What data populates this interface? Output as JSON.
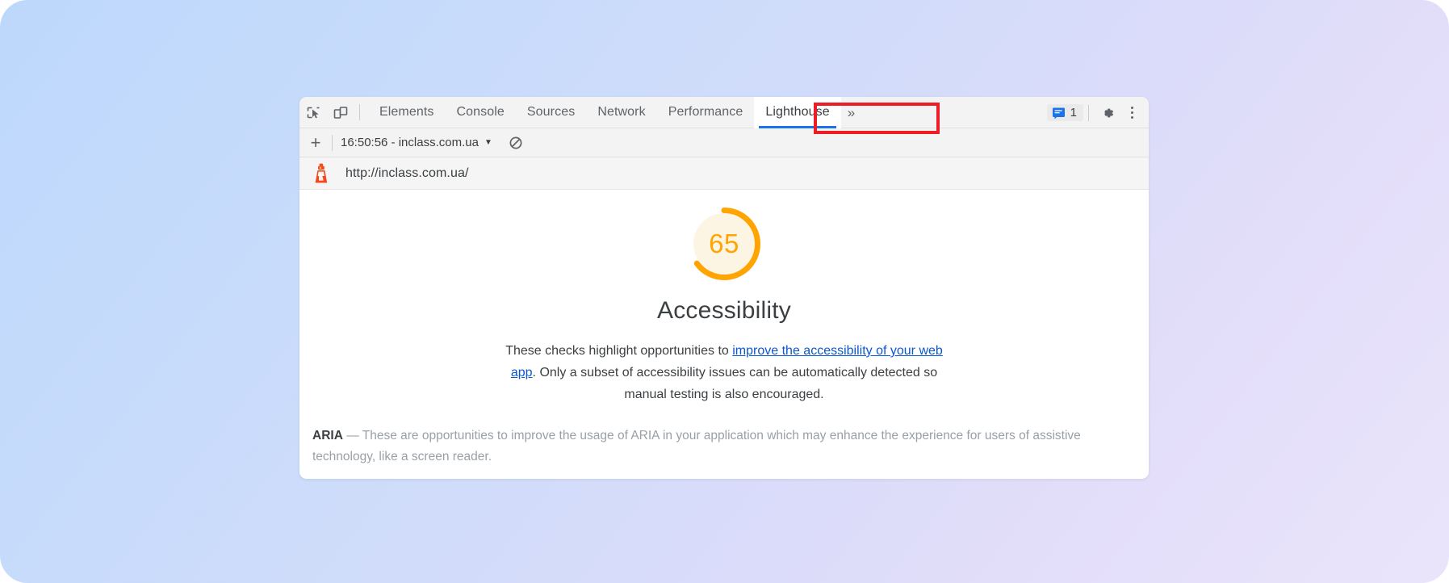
{
  "window": {
    "title": "Chrome DevTools - Lighthouse"
  },
  "toolbar": {
    "inspect_tooltip": "Inspect element",
    "device_tooltip": "Toggle device toolbar",
    "tabs": [
      {
        "label": "Elements",
        "active": false
      },
      {
        "label": "Console",
        "active": false
      },
      {
        "label": "Sources",
        "active": false
      },
      {
        "label": "Network",
        "active": false
      },
      {
        "label": "Performance",
        "active": false
      },
      {
        "label": "Lighthouse",
        "active": true
      }
    ],
    "more_tabs_glyph": "»",
    "message_count": "1",
    "settings_tooltip": "Settings",
    "menu_tooltip": "Customize and control DevTools"
  },
  "lighthouse_toolbar": {
    "add_label": "+",
    "report_selector": "16:50:56 - inclass.com.ua",
    "caret": "▼",
    "clear_tooltip": "Clear all"
  },
  "url_bar": {
    "url": "http://inclass.com.ua/"
  },
  "report": {
    "score": "65",
    "score_percent": 65,
    "category": "Accessibility",
    "description_before_link": "These checks highlight opportunities to ",
    "description_link": "improve the accessibility of your web app",
    "description_after_link": ". Only a subset of accessibility issues can be automatically detected so manual testing is also encouraged.",
    "group_title": "ARIA",
    "group_dash": " — ",
    "group_description": "These are opportunities to improve the usage of ARIA in your application which may enhance the experience for users of assistive technology, like a screen reader."
  },
  "annotation": {
    "target": "Lighthouse tab",
    "color": "#ee1c25"
  },
  "colors": {
    "score_orange": "#ffa400",
    "gauge_bg": "#fdf5e4",
    "active_tab_underline": "#1a73e8",
    "link_blue": "#0b57d0",
    "wallpaper_start": "#bdd8fc",
    "wallpaper_end": "#eae4fb"
  }
}
